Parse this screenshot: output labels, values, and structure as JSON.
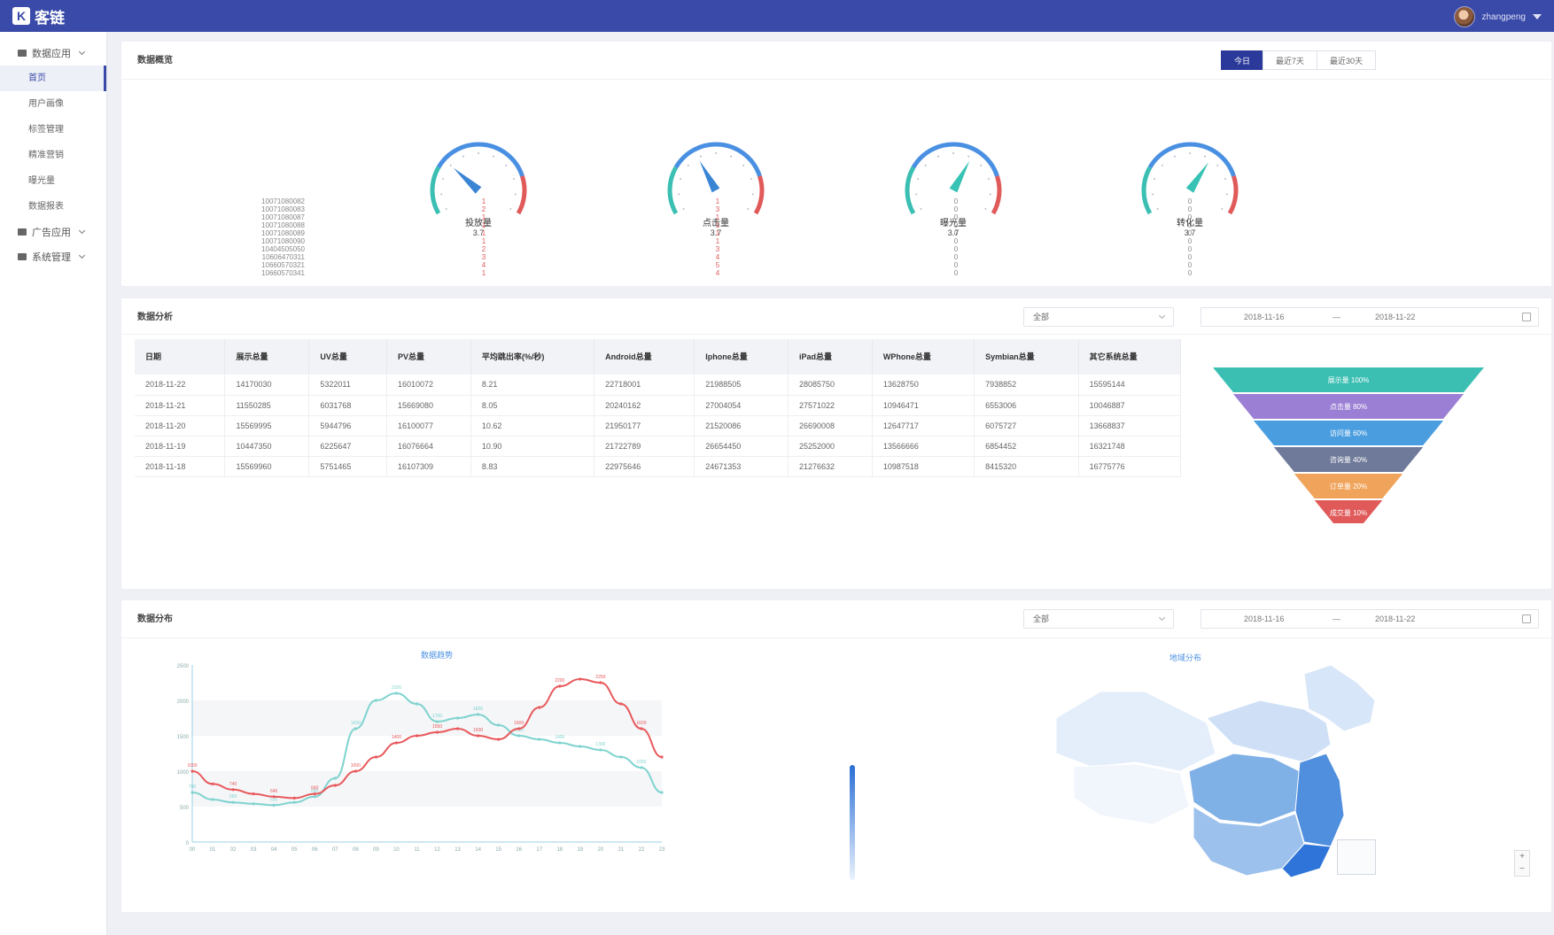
{
  "header": {
    "logo_glyph": "K",
    "logo_text": "客链",
    "username": "zhangpeng"
  },
  "sidebar": {
    "groups": [
      {
        "label": "数据应用"
      },
      {
        "label": "广告应用"
      },
      {
        "label": "系统管理"
      }
    ],
    "items": [
      {
        "label": "首页"
      },
      {
        "label": "用户画像"
      },
      {
        "label": "标签管理"
      },
      {
        "label": "精准营销"
      },
      {
        "label": "曝光量"
      },
      {
        "label": "数据报表"
      }
    ]
  },
  "overview": {
    "title": "数据概览",
    "tabs": [
      "今日",
      "最近7天",
      "最近30天"
    ],
    "gauges": [
      {
        "label": "投放量",
        "sub": "3.7",
        "value": 0.3,
        "color": "#3a84d4"
      },
      {
        "label": "点击量",
        "sub": "3.7",
        "value": 0.38,
        "color": "#3a84d4"
      },
      {
        "label": "曝光量",
        "sub": "3.7",
        "value": 0.62,
        "color": "#36c2b4"
      },
      {
        "label": "转化量",
        "sub": "3.7",
        "value": 0.64,
        "color": "#36c2b4"
      }
    ],
    "ids": [
      "10071080082",
      "10071080083",
      "10071080087",
      "10071080088",
      "10071080089",
      "10071080090",
      "10404505050",
      "10606470311",
      "10660570321",
      "10660570341"
    ],
    "columns": [
      [
        "1",
        "2",
        "1",
        "1",
        "1",
        "1",
        "2",
        "3",
        "4",
        "1"
      ],
      [
        "1",
        "3",
        "1",
        "1",
        "1",
        "1",
        "3",
        "4",
        "5",
        "4"
      ],
      [
        "0",
        "0",
        "0",
        "0",
        "0",
        "0",
        "0",
        "0",
        "0",
        "0"
      ],
      [
        "0",
        "0",
        "0",
        "0",
        "0",
        "0",
        "0",
        "0",
        "0",
        "0"
      ]
    ]
  },
  "analysis": {
    "title": "数据分析",
    "filter": "全部",
    "date_start": "2018-11-16",
    "date_sep": "—",
    "date_end": "2018-11-22",
    "headers": [
      "日期",
      "展示总量",
      "UV总量",
      "PV总量",
      "平均跳出率(%/秒)",
      "Android总量",
      "Iphone总量",
      "iPad总量",
      "WPhone总量",
      "Symbian总量",
      "其它系统总量"
    ],
    "rows": [
      [
        "2018-11-22",
        "14170030",
        "5322011",
        "16010072",
        "8.21",
        "22718001",
        "21988505",
        "28085750",
        "13628750",
        "7938852",
        "15595144"
      ],
      [
        "2018-11-21",
        "11550285",
        "6031768",
        "15669080",
        "8.05",
        "20240162",
        "27004054",
        "27571022",
        "10946471",
        "6553006",
        "10046887"
      ],
      [
        "2018-11-20",
        "15569995",
        "5944796",
        "16100077",
        "10.62",
        "21950177",
        "21520086",
        "26690008",
        "12647717",
        "6075727",
        "13668837"
      ],
      [
        "2018-11-19",
        "10447350",
        "6225647",
        "16076664",
        "10.90",
        "21722789",
        "26654450",
        "25252000",
        "13566666",
        "6854452",
        "16321748"
      ],
      [
        "2018-11-18",
        "15569960",
        "5751465",
        "16107309",
        "8.83",
        "22975646",
        "24671353",
        "21276632",
        "10987518",
        "8415320",
        "16775776"
      ]
    ],
    "funnel": [
      {
        "label": "展示量 100%",
        "color": "#3bbfb3"
      },
      {
        "label": "点击量 80%",
        "color": "#9b7fd4"
      },
      {
        "label": "访问量 60%",
        "color": "#4a9ee0"
      },
      {
        "label": "咨询量 40%",
        "color": "#6f7a9a"
      },
      {
        "label": "订单量 20%",
        "color": "#f0a35a"
      },
      {
        "label": "成交量 10%",
        "color": "#e05a5a"
      }
    ]
  },
  "distribution": {
    "title": "数据分布",
    "filter": "全部",
    "date_start": "2018-11-16",
    "date_sep": "—",
    "date_end": "2018-11-22",
    "line_title": "数据趋势",
    "map_title": "地域分布",
    "map_zoom_in": "+",
    "map_zoom_out": "−"
  },
  "chart_data": {
    "type": "line",
    "x": [
      "00",
      "01",
      "02",
      "03",
      "04",
      "05",
      "06",
      "07",
      "08",
      "09",
      "10",
      "11",
      "12",
      "13",
      "14",
      "15",
      "16",
      "17",
      "18",
      "19",
      "20",
      "21",
      "22",
      "23"
    ],
    "ylim": [
      0,
      2500
    ],
    "series": [
      {
        "values": [
          700,
          600,
          560,
          540,
          520,
          560,
          640,
          900,
          1600,
          2000,
          2100,
          1950,
          1700,
          1750,
          1800,
          1650,
          1500,
          1450,
          1400,
          1350,
          1300,
          1200,
          1050,
          700
        ],
        "color": "#7fd3cf"
      },
      {
        "values": [
          1000,
          820,
          740,
          680,
          640,
          620,
          680,
          800,
          1000,
          1200,
          1400,
          1500,
          1550,
          1600,
          1500,
          1450,
          1600,
          1900,
          2200,
          2300,
          2250,
          1950,
          1600,
          1200
        ],
        "color": "#e8595c"
      }
    ]
  }
}
